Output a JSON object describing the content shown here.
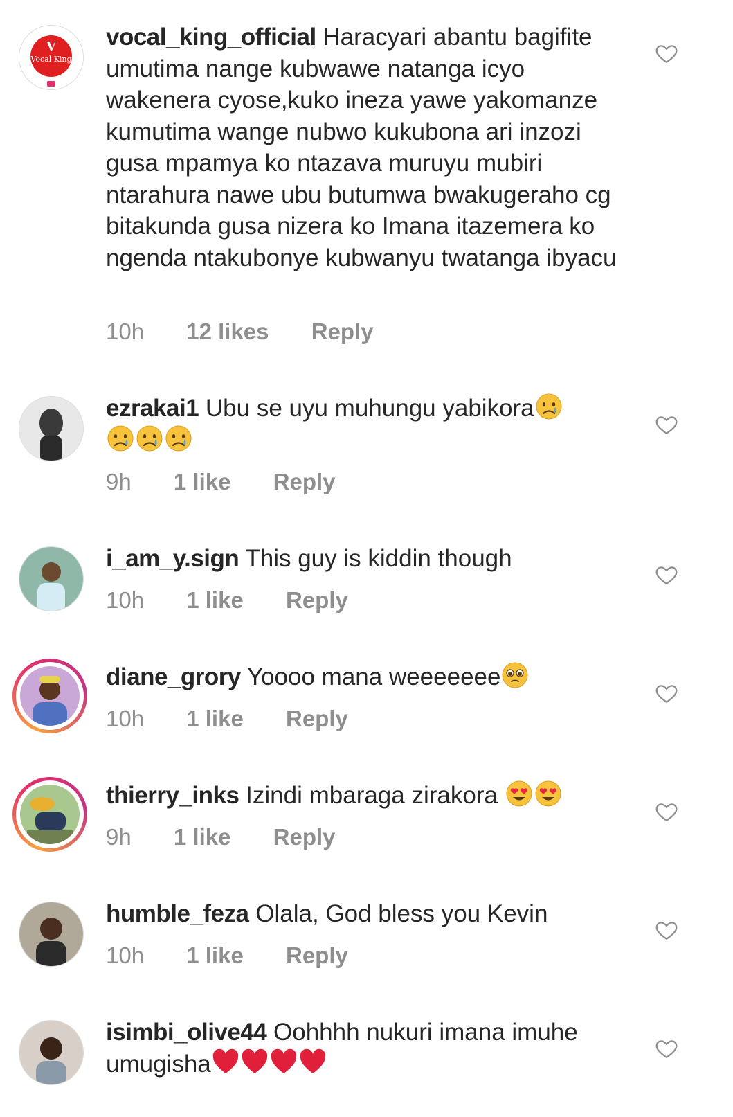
{
  "comments": [
    {
      "username": "vocal_king_official",
      "text": "Haracyari abantu bagifite umutima nange kubwawe natanga icyo wakenera cyose,kuko ineza yawe yakomanze kumutima wange nubwo kukubona ari inzozi gusa mpamya ko ntazava muruyu mubiri ntarahura nawe ubu butumwa bwakugeraho cg bitakunda gusa nizera ko Imana itazemera ko ngenda ntakubonye kubwanyu twatanga ibyacu",
      "time": "10h",
      "likes": "12 likes",
      "reply": "Reply",
      "avatar_text": "Vocal King"
    },
    {
      "username": "ezrakai1",
      "text": "Ubu se uyu muhungu yabikora",
      "emojis": [
        "crying-face",
        "crying-face",
        "crying-face",
        "crying-face"
      ],
      "time": "9h",
      "likes": "1 like",
      "reply": "Reply"
    },
    {
      "username": "i_am_y.sign",
      "text": "This guy is kiddin though",
      "time": "10h",
      "likes": "1 like",
      "reply": "Reply"
    },
    {
      "username": "diane_grory",
      "text": "Yoooo mana weeeeeee",
      "emojis": [
        "pleading-face"
      ],
      "time": "10h",
      "likes": "1 like",
      "reply": "Reply"
    },
    {
      "username": "thierry_inks",
      "text": "Izindi mbaraga zirakora ",
      "emojis": [
        "heart-eyes-face",
        "heart-eyes-face"
      ],
      "time": "9h",
      "likes": "1 like",
      "reply": "Reply"
    },
    {
      "username": "humble_feza",
      "text": "Olala, God bless you Kevin",
      "time": "10h",
      "likes": "1 like",
      "reply": "Reply"
    },
    {
      "username": "isimbi_olive44",
      "text": "Oohhhh nukuri imana imuhe umugisha",
      "emojis": [
        "red-heart",
        "red-heart",
        "red-heart",
        "red-heart"
      ]
    }
  ],
  "colors": {
    "text": "#262626",
    "secondary": "#8e8e8e",
    "story_ring": "#e1306c",
    "heart_outline": "#8e8e8e"
  }
}
